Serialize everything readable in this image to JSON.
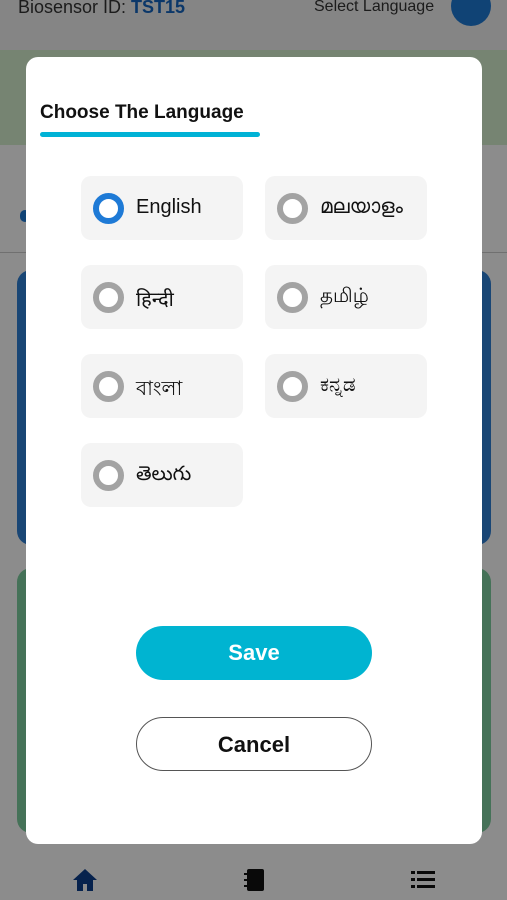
{
  "background": {
    "biosensor_label": "Biosensor ID: ",
    "biosensor_id": "TST15",
    "select_language_label": "Select Language"
  },
  "modal": {
    "title": "Choose The Language",
    "options": [
      {
        "label": "English",
        "selected": true
      },
      {
        "label": "മലയാളം",
        "selected": false
      },
      {
        "label": "हिन्दी",
        "selected": false
      },
      {
        "label": "தமிழ்",
        "selected": false
      },
      {
        "label": "বাংলা",
        "selected": false
      },
      {
        "label": "ಕನ್ನಡ",
        "selected": false
      },
      {
        "label": "తెలుగు",
        "selected": false
      }
    ],
    "save_label": "Save",
    "cancel_label": "Cancel"
  },
  "bottom_nav": {
    "icons": [
      "home-icon",
      "notebook-icon",
      "list-icon"
    ]
  },
  "colors": {
    "accent": "#00b4d1",
    "selected_radio": "#1e7ad6",
    "unselected_radio": "#a3a3a3"
  }
}
